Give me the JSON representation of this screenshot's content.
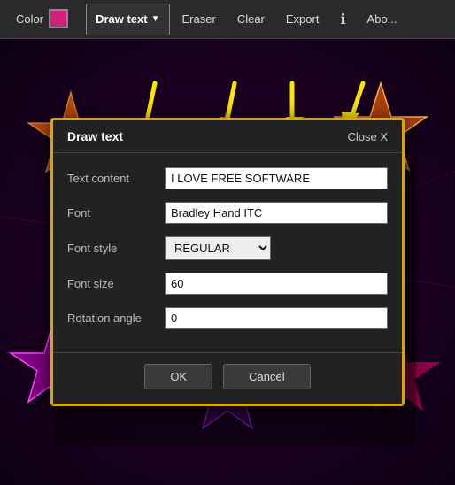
{
  "toolbar": {
    "color_label": "Color",
    "draw_text_label": "Draw text",
    "eraser_label": "Eraser",
    "clear_label": "Clear",
    "export_label": "Export",
    "about_label": "Abo..."
  },
  "dialog": {
    "title": "Draw text",
    "close_label": "Close X",
    "fields": {
      "text_content_label": "Text content",
      "text_content_value": "I LOVE FREE SOFTWARE",
      "font_label": "Font",
      "font_value": "Bradley Hand ITC",
      "font_style_label": "Font style",
      "font_style_value": "REGULAR",
      "font_size_label": "Font size",
      "font_size_value": "60",
      "rotation_label": "Rotation angle",
      "rotation_value": "0"
    },
    "ok_label": "OK",
    "cancel_label": "Cancel"
  }
}
